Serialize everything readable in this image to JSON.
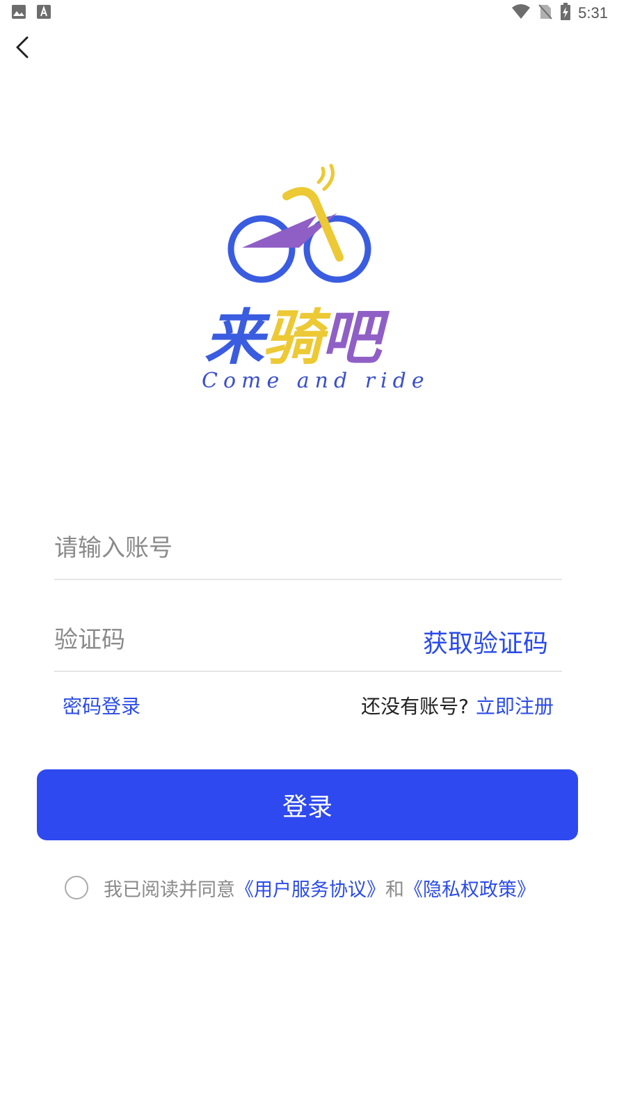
{
  "status_bar": {
    "time": "5:31",
    "icons": [
      "image-icon",
      "a-icon",
      "wifi-icon",
      "no-sim-icon",
      "battery-charging-icon"
    ]
  },
  "header": {
    "back_icon": "chevron-left-icon"
  },
  "logo": {
    "char1": "来",
    "char2": "骑",
    "char3": "吧",
    "slogan": "Come and ride",
    "colors": {
      "blue": "#3a5ce0",
      "yellow": "#ecc935",
      "purple": "#8f5fc5"
    }
  },
  "form": {
    "account": {
      "value": "",
      "placeholder": "请输入账号"
    },
    "code": {
      "value": "",
      "placeholder": "验证码"
    },
    "get_code_label": "获取验证码",
    "password_login_label": "密码登录",
    "no_account_text": "还没有账号?",
    "register_label": "立即注册",
    "login_button_label": "登录"
  },
  "agreement": {
    "checked": false,
    "prefix": "我已阅读并同意",
    "user_agreement": "《用户服务协议》",
    "conjunction": "和",
    "privacy_policy": "《隐私权政策》"
  },
  "colors": {
    "accent": "#2d49ef",
    "link": "#2b4be8",
    "muted": "#8a8a8a"
  }
}
